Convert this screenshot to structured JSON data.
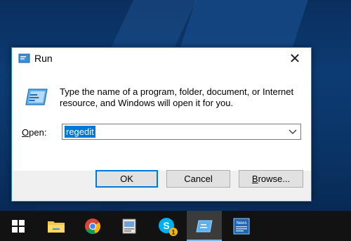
{
  "dialog": {
    "title": "Run",
    "close_glyph": "✕",
    "description": "Type the name of a program, folder, document, or Internet resource, and Windows will open it for you.",
    "open_label_accel": "O",
    "open_label_rest": "pen:",
    "open_value": "regedit",
    "buttons": {
      "ok": "OK",
      "cancel": "Cancel",
      "browse_accel": "B",
      "browse_rest": "rowse..."
    }
  },
  "taskbar": {
    "items": [
      {
        "name": "start-button",
        "icon": "windows-logo-icon"
      },
      {
        "name": "file-explorer",
        "icon": "folder-icon"
      },
      {
        "name": "chrome",
        "icon": "chrome-icon"
      },
      {
        "name": "app-3",
        "icon": "document-app-icon"
      },
      {
        "name": "skype",
        "icon": "skype-icon",
        "badge": "1"
      },
      {
        "name": "run-dialog",
        "icon": "run-icon",
        "active": true
      },
      {
        "name": "news",
        "icon": "news-icon",
        "text": "News"
      }
    ]
  },
  "colors": {
    "accent": "#0078d7",
    "window_border": "#1883d7",
    "taskbar": "#121212",
    "desktop": "#0c3b73"
  }
}
